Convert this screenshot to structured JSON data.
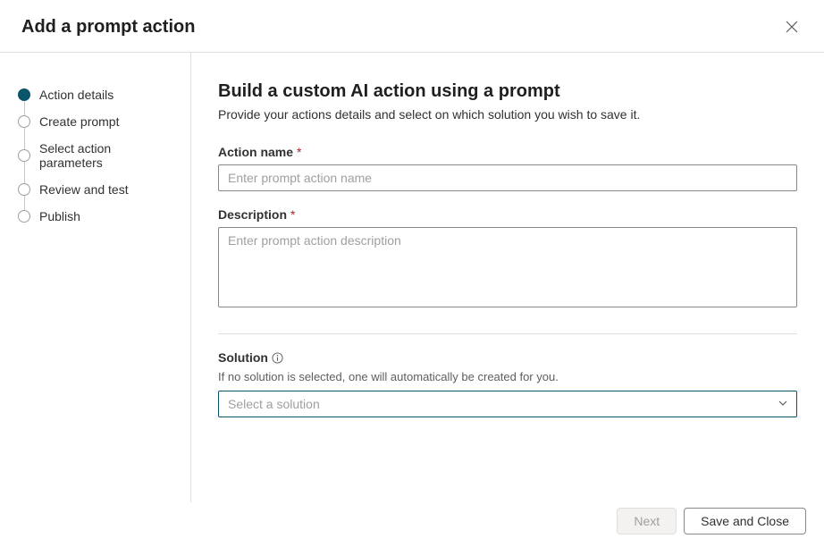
{
  "header": {
    "title": "Add a prompt action"
  },
  "sidebar": {
    "steps": [
      {
        "label": "Action details",
        "active": true
      },
      {
        "label": "Create prompt",
        "active": false
      },
      {
        "label": "Select action parameters",
        "active": false
      },
      {
        "label": "Review and test",
        "active": false
      },
      {
        "label": "Publish",
        "active": false
      }
    ]
  },
  "main": {
    "heading": "Build a custom AI action using a prompt",
    "subtitle": "Provide your actions details and select on which solution you wish to save it.",
    "fields": {
      "action_name": {
        "label": "Action name",
        "required_mark": "*",
        "placeholder": "Enter prompt action name",
        "value": ""
      },
      "description": {
        "label": "Description",
        "required_mark": "*",
        "placeholder": "Enter prompt action description",
        "value": ""
      },
      "solution": {
        "label": "Solution",
        "helper": "If no solution is selected, one will automatically be created for you.",
        "placeholder": "Select a solution",
        "selected": ""
      }
    }
  },
  "footer": {
    "next_label": "Next",
    "save_close_label": "Save and Close"
  }
}
